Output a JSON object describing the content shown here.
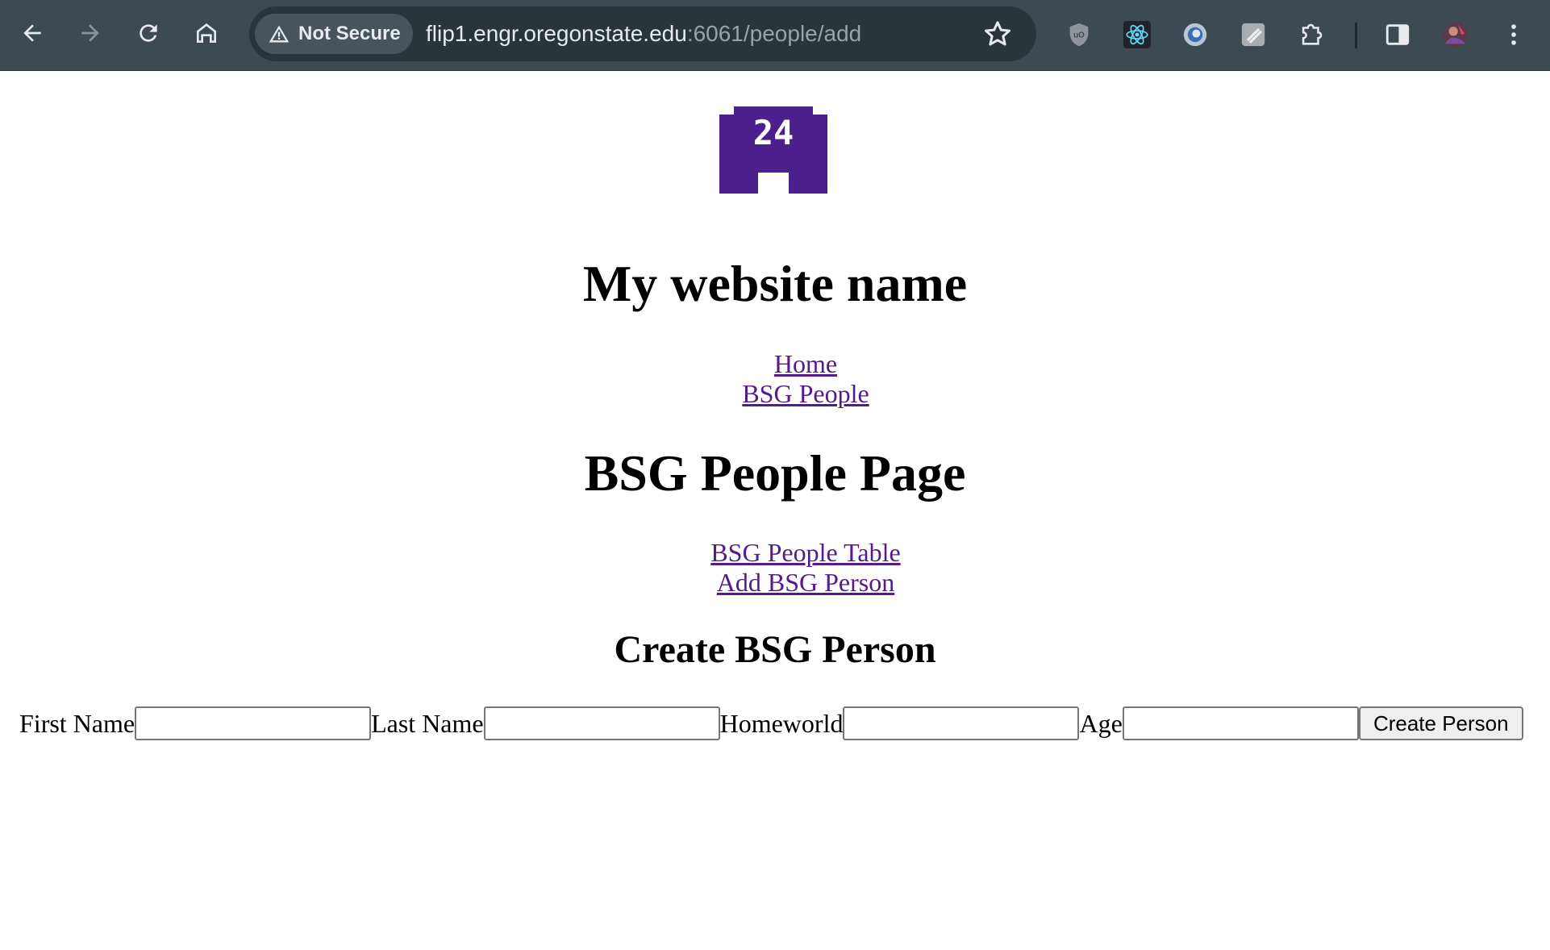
{
  "browser": {
    "security_label": "Not Secure",
    "url_host": "flip1.engr.oregonstate.edu",
    "url_rest": ":6061/people/add"
  },
  "site": {
    "logo_text": "24",
    "title": "My website name",
    "nav": [
      "Home",
      "BSG People"
    ]
  },
  "page": {
    "heading": "BSG People Page",
    "links": [
      "BSG People Table",
      "Add BSG Person"
    ]
  },
  "form": {
    "heading": "Create BSG Person",
    "fields": [
      {
        "label": "First Name",
        "value": ""
      },
      {
        "label": "Last Name",
        "value": ""
      },
      {
        "label": "Homeworld",
        "value": ""
      },
      {
        "label": "Age",
        "value": ""
      }
    ],
    "submit_label": "Create Person"
  },
  "colors": {
    "chrome": "#3c4a52",
    "link_visited": "#551a8b",
    "logo": "#4b1f8c"
  }
}
